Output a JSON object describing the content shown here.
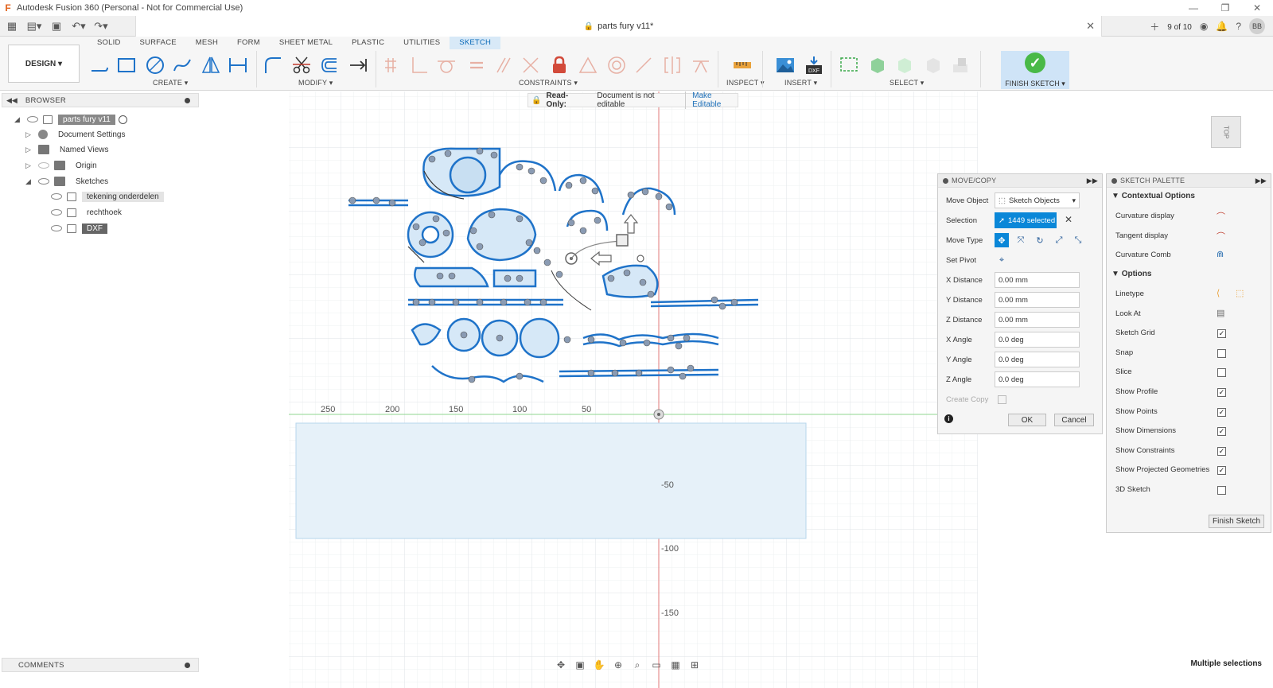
{
  "window": {
    "title": "Autodesk Fusion 360 (Personal - Not for Commercial Use)",
    "app_logo": "F"
  },
  "doc_tab": {
    "title": "parts fury v11*",
    "job_status": "9 of 10",
    "avatar": "BB"
  },
  "ribbon": {
    "tabs": [
      "SOLID",
      "SURFACE",
      "MESH",
      "FORM",
      "SHEET METAL",
      "PLASTIC",
      "UTILITIES",
      "SKETCH"
    ],
    "active_tab": "SKETCH",
    "workspace": "DESIGN ▾",
    "groups": {
      "create": "CREATE ▾",
      "modify": "MODIFY ▾",
      "constraints": "CONSTRAINTS ▾",
      "inspect": "INSPECT ▾",
      "insert": "INSERT ▾",
      "select": "SELECT ▾",
      "finish": "FINISH SKETCH ▾"
    }
  },
  "browser": {
    "label": "BROWSER",
    "root": "parts fury v11",
    "items": [
      "Document Settings",
      "Named Views",
      "Origin",
      "Sketches"
    ],
    "sketches": [
      "tekening onderdelen",
      "rechthoek",
      "DXF"
    ]
  },
  "readonly_banner": {
    "label": "Read-Only:",
    "description": "Document is not editable",
    "action": "Make Editable"
  },
  "viewcube": {
    "face": "TOP"
  },
  "ruler": {
    "x_ticks": [
      "250",
      "200",
      "150",
      "100",
      "50"
    ],
    "y_ticks": [
      "-50",
      "-100",
      "-150"
    ]
  },
  "move_copy": {
    "title": "MOVE/COPY",
    "move_object_label": "Move Object",
    "move_object_value": "Sketch Objects",
    "selection_label": "Selection",
    "selection_value": "1449 selected",
    "move_type_label": "Move Type",
    "set_pivot_label": "Set Pivot",
    "fields": [
      {
        "label": "X Distance",
        "value": "0.00 mm"
      },
      {
        "label": "Y Distance",
        "value": "0.00 mm"
      },
      {
        "label": "Z Distance",
        "value": "0.00 mm"
      },
      {
        "label": "X Angle",
        "value": "0.0 deg"
      },
      {
        "label": "Y Angle",
        "value": "0.0 deg"
      },
      {
        "label": "Z Angle",
        "value": "0.0 deg"
      }
    ],
    "create_copy_label": "Create Copy",
    "ok": "OK",
    "cancel": "Cancel"
  },
  "sketch_palette": {
    "title": "SKETCH PALETTE",
    "contextual_header": "Contextual Options",
    "contextual": [
      "Curvature display",
      "Tangent display",
      "Curvature Comb"
    ],
    "options_header": "Options",
    "linetype": "Linetype",
    "look_at": "Look At",
    "options": [
      {
        "label": "Sketch Grid",
        "checked": true
      },
      {
        "label": "Snap",
        "checked": false
      },
      {
        "label": "Slice",
        "checked": false
      },
      {
        "label": "Show Profile",
        "checked": true
      },
      {
        "label": "Show Points",
        "checked": true
      },
      {
        "label": "Show Dimensions",
        "checked": true
      },
      {
        "label": "Show Constraints",
        "checked": true
      },
      {
        "label": "Show Projected Geometries",
        "checked": true
      },
      {
        "label": "3D Sketch",
        "checked": false
      }
    ],
    "finish_button": "Finish Sketch"
  },
  "comments": {
    "label": "COMMENTS"
  },
  "status": {
    "text": "Multiple selections"
  },
  "colors": {
    "sketch_blue": "#1f73c9",
    "selection_blue": "#0a87d8",
    "x_axis": "#7fd37f",
    "y_axis": "#d84a4a"
  }
}
